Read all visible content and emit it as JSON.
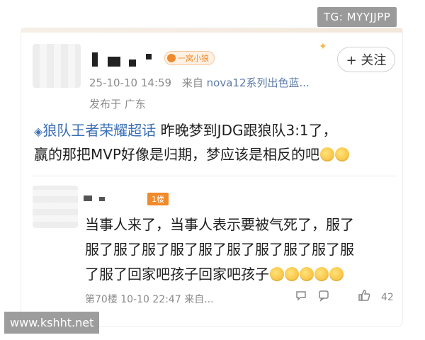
{
  "watermark": {
    "tg": "TG: MYYJJPP",
    "site": "www.kshht.net"
  },
  "post": {
    "badge": "一窝小狼",
    "timestamp": "25-10-10 14:59",
    "source_prefix": "来自",
    "source": "nova12系列出色蓝...",
    "location": "发布于 广东",
    "follow_label": "+ 关注",
    "topic": "狼队王者荣耀超话",
    "text_after_topic": "昨晚梦到JDG跟狼队3:1了，",
    "text_line2": "赢的那把MVP好像是归期，梦应该是相反的吧"
  },
  "reply": {
    "floor_tag": "1楼",
    "line1": "当事人来了，当事人表示要被气死了，服了",
    "line2": "服了服了服了服了服了服了服了服了服了服",
    "line3": "了服了回家吧孩子回家吧孩子",
    "meta": "第70楼 10-10 22:47 来自...",
    "likes": "42"
  },
  "colors": {
    "accent": "#f08a2b",
    "link": "#3a6fb5"
  },
  "icons": [
    "reply-icon",
    "comment-icon",
    "like-icon",
    "sparkle-icon",
    "diamond-icon"
  ]
}
